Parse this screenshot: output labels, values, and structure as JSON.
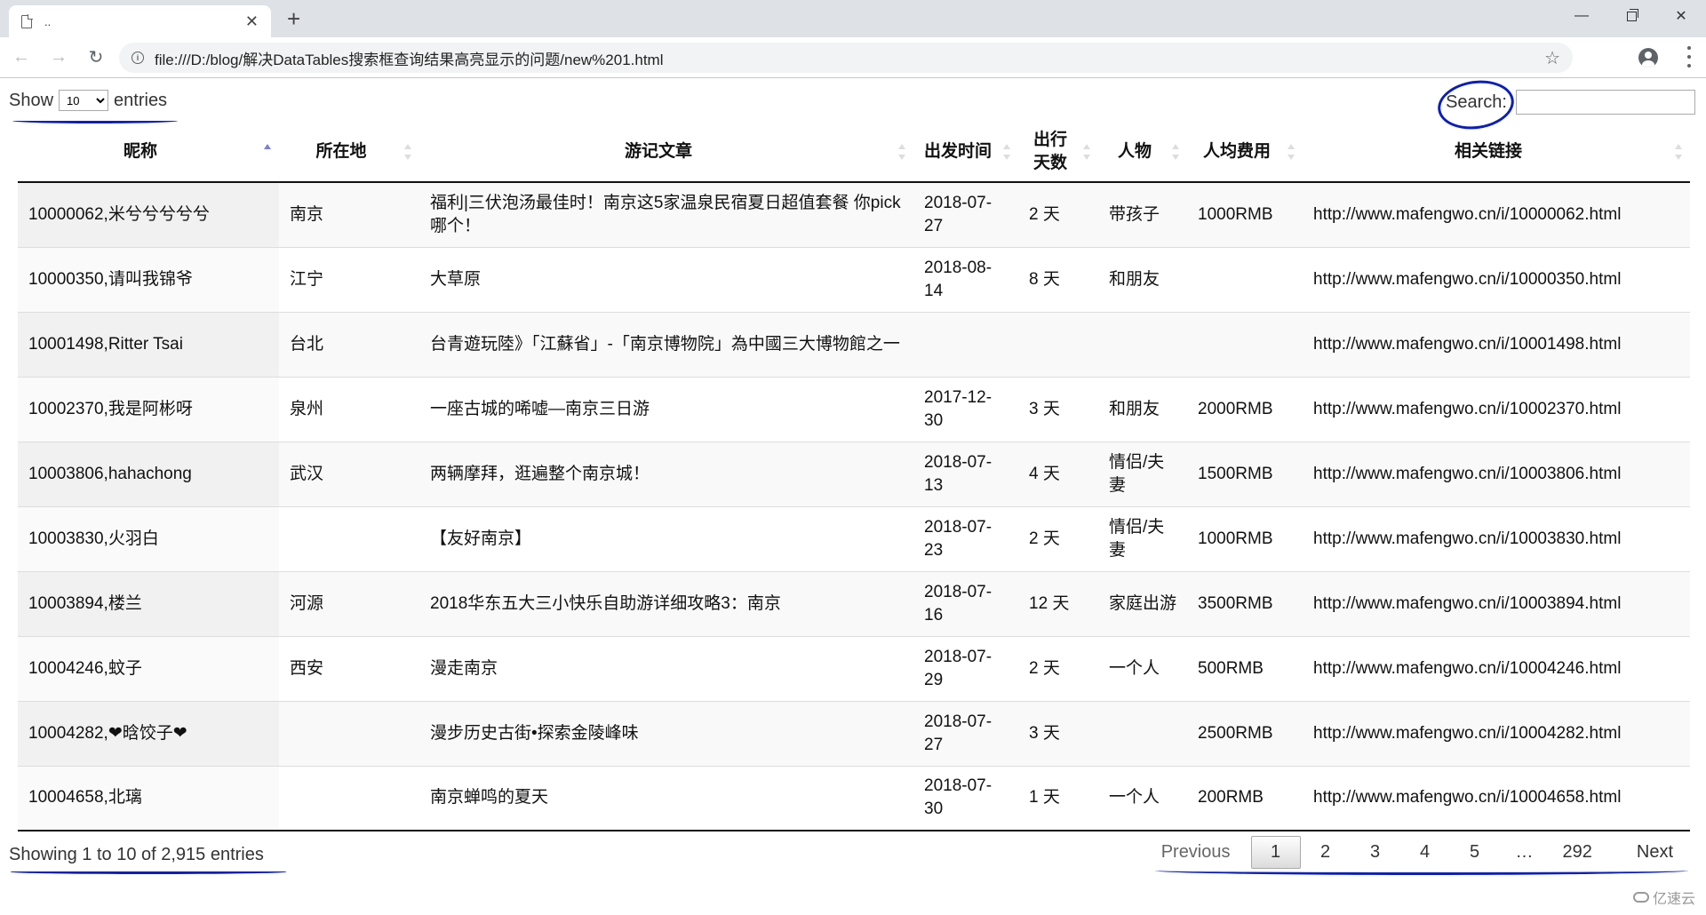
{
  "browser": {
    "tab_title": "..",
    "url": "file:///D:/blog/解决DataTables搜索框查询结果高亮显示的问题/new%201.html",
    "icons": {
      "tab": "document-icon",
      "close": "close-icon",
      "new_tab": "plus-icon",
      "back": "arrow-left-icon",
      "forward": "arrow-right-icon",
      "reload": "reload-icon",
      "info": "info-icon",
      "bookmark": "star-icon",
      "profile": "profile-icon",
      "menu": "kebab-menu-icon"
    },
    "window_controls": {
      "minimize": "—",
      "close": "✕"
    }
  },
  "length_menu": {
    "prefix": "Show",
    "selected": "10",
    "suffix": "entries"
  },
  "search": {
    "label": "Search:",
    "value": "",
    "placeholder": ""
  },
  "table": {
    "sorted_column": 0,
    "sort_direction": "asc",
    "columns": [
      {
        "label": "昵称"
      },
      {
        "label": "所在地"
      },
      {
        "label": "游记文章"
      },
      {
        "label": "出发时间"
      },
      {
        "label": "出行天数"
      },
      {
        "label": "人物"
      },
      {
        "label": "人均费用"
      },
      {
        "label": "相关链接"
      }
    ],
    "rows": [
      [
        "10000062,米兮兮兮兮兮",
        "南京",
        "福利|三伏泡汤最佳时！南京这5家温泉民宿夏日超值套餐 你pick哪个！",
        "2018-07-27",
        "2 天",
        "带孩子",
        "1000RMB",
        "http://www.mafengwo.cn/i/10000062.html"
      ],
      [
        "10000350,请叫我锦爷",
        "江宁",
        "大草原",
        "2018-08-14",
        "8 天",
        "和朋友",
        "",
        "http://www.mafengwo.cn/i/10000350.html"
      ],
      [
        "10001498,Ritter Tsai",
        "台北",
        "台青遊玩陸》「江蘇省」-「南京博物院」為中國三大博物館之一",
        "",
        "",
        "",
        "",
        "http://www.mafengwo.cn/i/10001498.html"
      ],
      [
        "10002370,我是阿彬呀",
        "泉州",
        "一座古城的唏嘘—南京三日游",
        "2017-12-30",
        "3 天",
        "和朋友",
        "2000RMB",
        "http://www.mafengwo.cn/i/10002370.html"
      ],
      [
        "10003806,hahachong",
        "武汉",
        "两辆摩拜，逛遍整个南京城！",
        "2018-07-13",
        "4 天",
        "情侣/夫妻",
        "1500RMB",
        "http://www.mafengwo.cn/i/10003806.html"
      ],
      [
        "10003830,火羽白",
        "",
        "【友好南京】",
        "2018-07-23",
        "2 天",
        "情侣/夫妻",
        "1000RMB",
        "http://www.mafengwo.cn/i/10003830.html"
      ],
      [
        "10003894,楼兰",
        "河源",
        "2018华东五大三小快乐自助游详细攻略3：南京",
        "2018-07-16",
        "12 天",
        "家庭出游",
        "3500RMB",
        "http://www.mafengwo.cn/i/10003894.html"
      ],
      [
        "10004246,蚊子",
        "西安",
        "漫走南京",
        "2018-07-29",
        "2 天",
        "一个人",
        "500RMB",
        "http://www.mafengwo.cn/i/10004246.html"
      ],
      [
        "10004282,❤晗饺子❤",
        "",
        "漫步历史古街•探索金陵峰味",
        "2018-07-27",
        "3 天",
        "",
        "2500RMB",
        "http://www.mafengwo.cn/i/10004282.html"
      ],
      [
        "10004658,北璃",
        "",
        "南京蝉鸣的夏天",
        "2018-07-30",
        "1 天",
        "一个人",
        "200RMB",
        "http://www.mafengwo.cn/i/10004658.html"
      ]
    ]
  },
  "info": "Showing 1 to 10 of 2,915 entries",
  "pagination": {
    "previous": "Previous",
    "next": "Next",
    "pages": [
      "1",
      "2",
      "3",
      "4",
      "5",
      "…",
      "292"
    ],
    "current": "1"
  },
  "watermark": "亿速云",
  "colors": {
    "annotation": "#0a1ebb",
    "sort_active": "#7b7fd6"
  }
}
